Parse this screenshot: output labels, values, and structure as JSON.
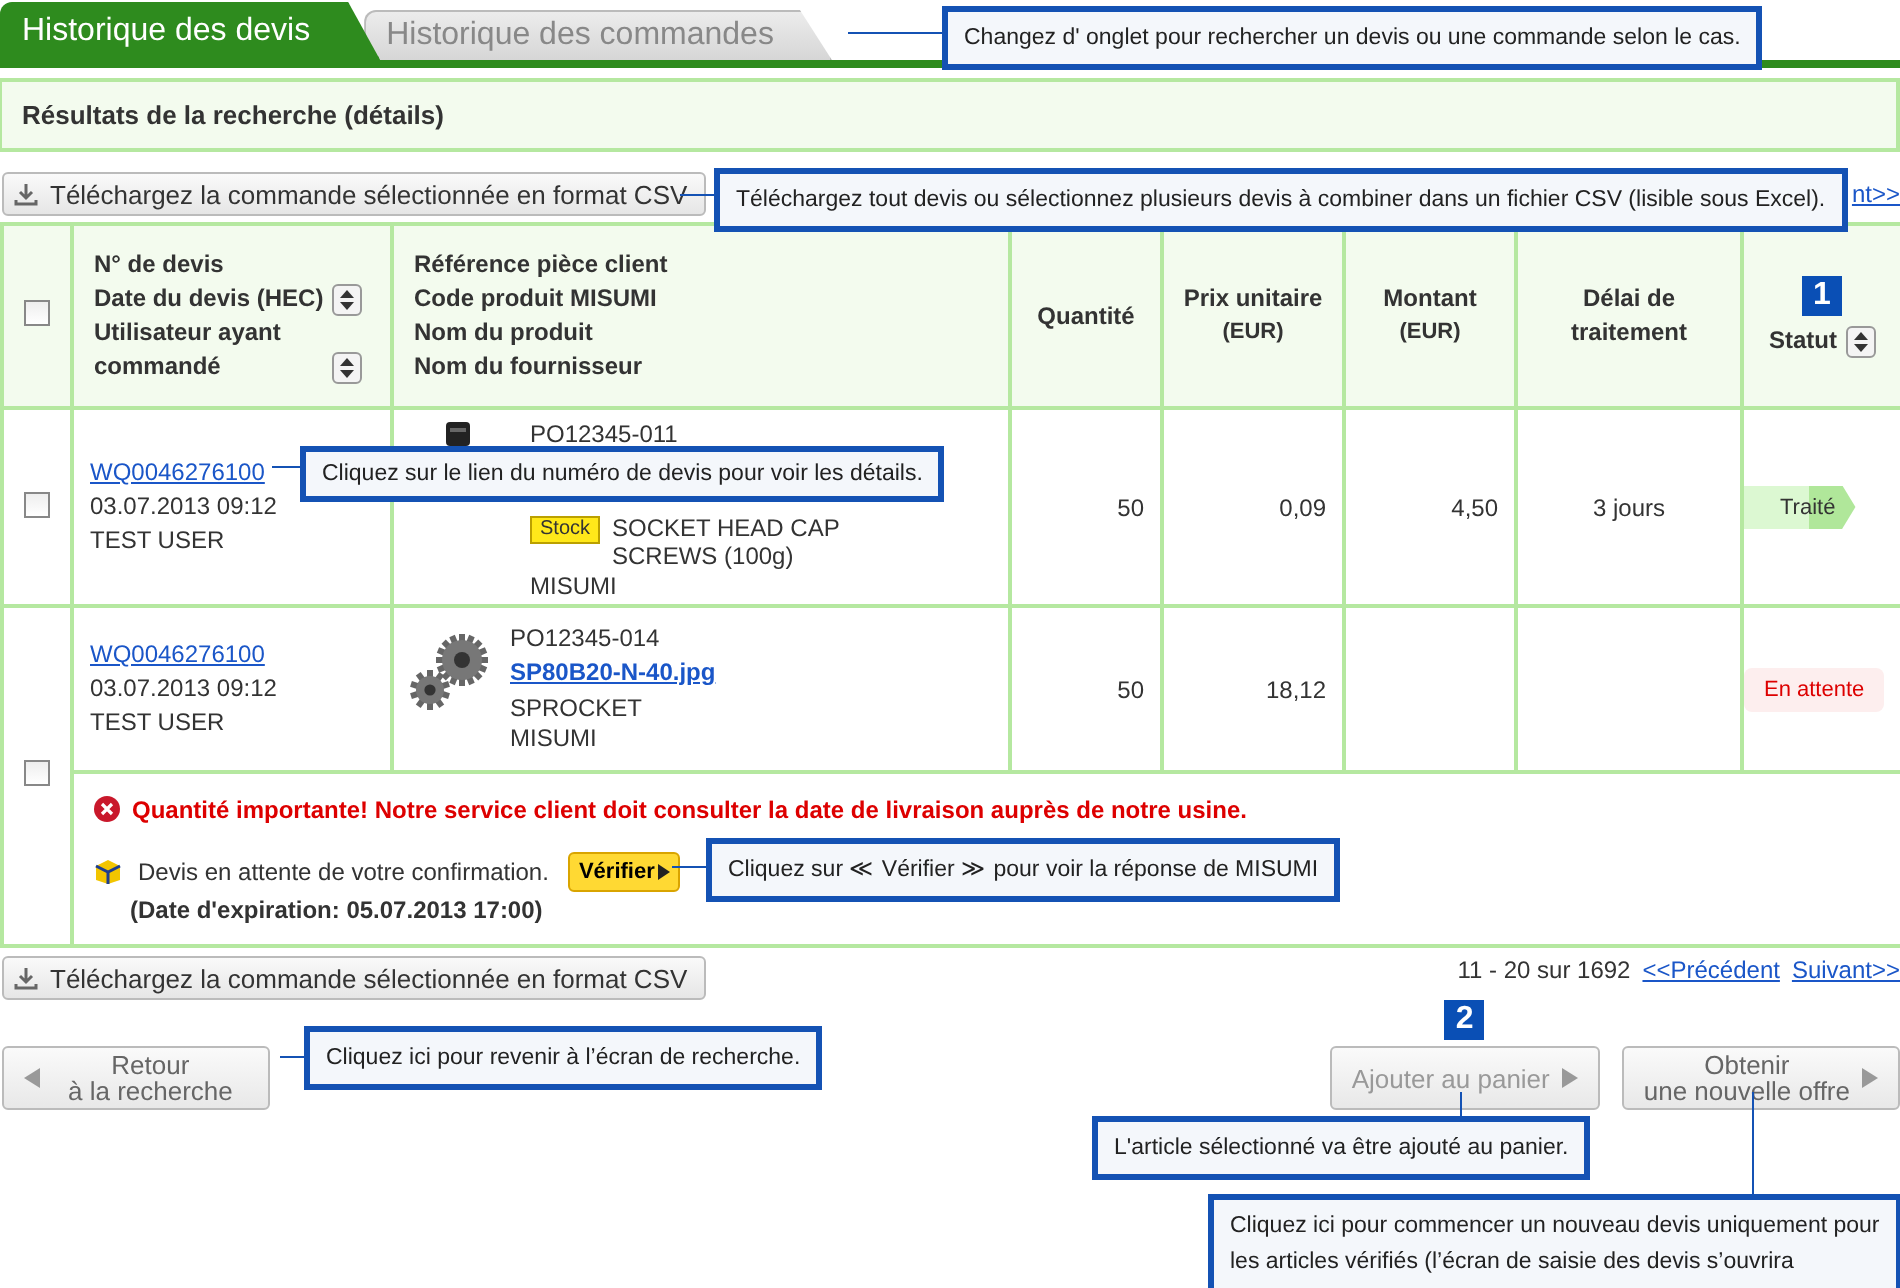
{
  "tabs": [
    {
      "label": "Historique des devis",
      "selected": true
    },
    {
      "label": "Historique des commandes",
      "selected": false
    }
  ],
  "section_title": "Résultats de la recherche (détails)",
  "csv_button_top": "Téléchargez la commande sélectionnée en format CSV",
  "top_pager_fragment": "nt>>",
  "table": {
    "select_all_checked": false,
    "columns": [
      {
        "lines": [
          {
            "text": "N° de devis",
            "sortable": false
          },
          {
            "text": "Date du devis (HEC)",
            "sortable": true
          },
          {
            "text": "Utilisateur ayant commandé",
            "sortable": true
          }
        ]
      },
      {
        "lines": [
          {
            "text": "Référence pièce client",
            "sortable": false
          },
          {
            "text": "Code produit MISUMI",
            "sortable": false
          },
          {
            "text": "Nom du produit",
            "sortable": false
          },
          {
            "text": "Nom du fournisseur",
            "sortable": false
          }
        ]
      },
      {
        "lines": [
          {
            "text": "Quantité",
            "sortable": false
          }
        ]
      },
      {
        "lines": [
          {
            "text": "Prix unitaire",
            "sortable": false
          }
        ],
        "unit": "(EUR)"
      },
      {
        "lines": [
          {
            "text": "Montant",
            "sortable": false
          }
        ],
        "unit": "(EUR)"
      },
      {
        "lines": [
          {
            "text": "Délai de traitement",
            "sortable": false
          }
        ]
      },
      {
        "lines": [
          {
            "text": "Statut",
            "sortable": true
          }
        ],
        "marker": "1"
      }
    ],
    "rows": [
      {
        "checked": false,
        "quote_no": "WQ0046276100",
        "date": "03.07.2013 09:12",
        "user": "TEST USER",
        "product": {
          "ref": "PO12345-011",
          "stock": "Stock",
          "name": "SOCKET HEAD CAP SCREWS (100g)",
          "supplier": "MISUMI"
        },
        "quantity": "50",
        "unit_price": "0,09",
        "amount": "4,50",
        "lead_time": "3 jours",
        "status": {
          "kind": "done",
          "label": "Traité"
        }
      },
      {
        "checked": false,
        "quote_no": "WQ0046276100",
        "date": "03.07.2013 09:12",
        "user": "TEST USER",
        "product": {
          "ref": "PO12345-014",
          "code": "SP80B20-N-40.jpg",
          "name": "SPROCKET",
          "supplier": "MISUMI"
        },
        "quantity": "50",
        "unit_price": "18,12",
        "status": {
          "kind": "pending",
          "label": "En attente"
        },
        "notice": {
          "warning": "Quantité importante! Notre service client doit consulter la date de livraison auprès de notre usine.",
          "pending_text": "Devis en attente de votre confirmation.",
          "verify_button": "Vérifier",
          "expiry": "(Date d'expiration: 05.07.2013 17:00)"
        }
      }
    ]
  },
  "csv_button_bottom": "Téléchargez la commande sélectionnée en format CSV",
  "pager": {
    "range": "11 - 20 sur 1692",
    "prev": "<<Précédent",
    "next": "Suivant>>"
  },
  "buttons": [
    {
      "kind": "back",
      "label": "Retour\nà la recherche"
    },
    {
      "kind": "forward",
      "label": "Ajouter au panier",
      "marker": "2"
    },
    {
      "kind": "forward",
      "label": "Obtenir\nune nouvelle offre"
    }
  ],
  "callouts": [
    "Changez d' onglet pour rechercher un devis ou une commande selon le cas.",
    "Téléchargez tout devis ou sélectionnez plusieurs devis à combiner dans un fichier CSV (lisible sous Excel).",
    "Cliquez sur le lien du numéro de devis pour voir les détails.",
    "Cliquez sur ≪ Vérifier ≫ pour voir la réponse de MISUMI",
    "Cliquez ici pour revenir à l’écran de recherche.",
    "L'article sélectionné va être ajouté au panier.",
    "Cliquez ici pour commencer un nouveau devis uniquement pour\nles articles vérifiés (l’écran de saisie des devis s’ouvrira"
  ]
}
